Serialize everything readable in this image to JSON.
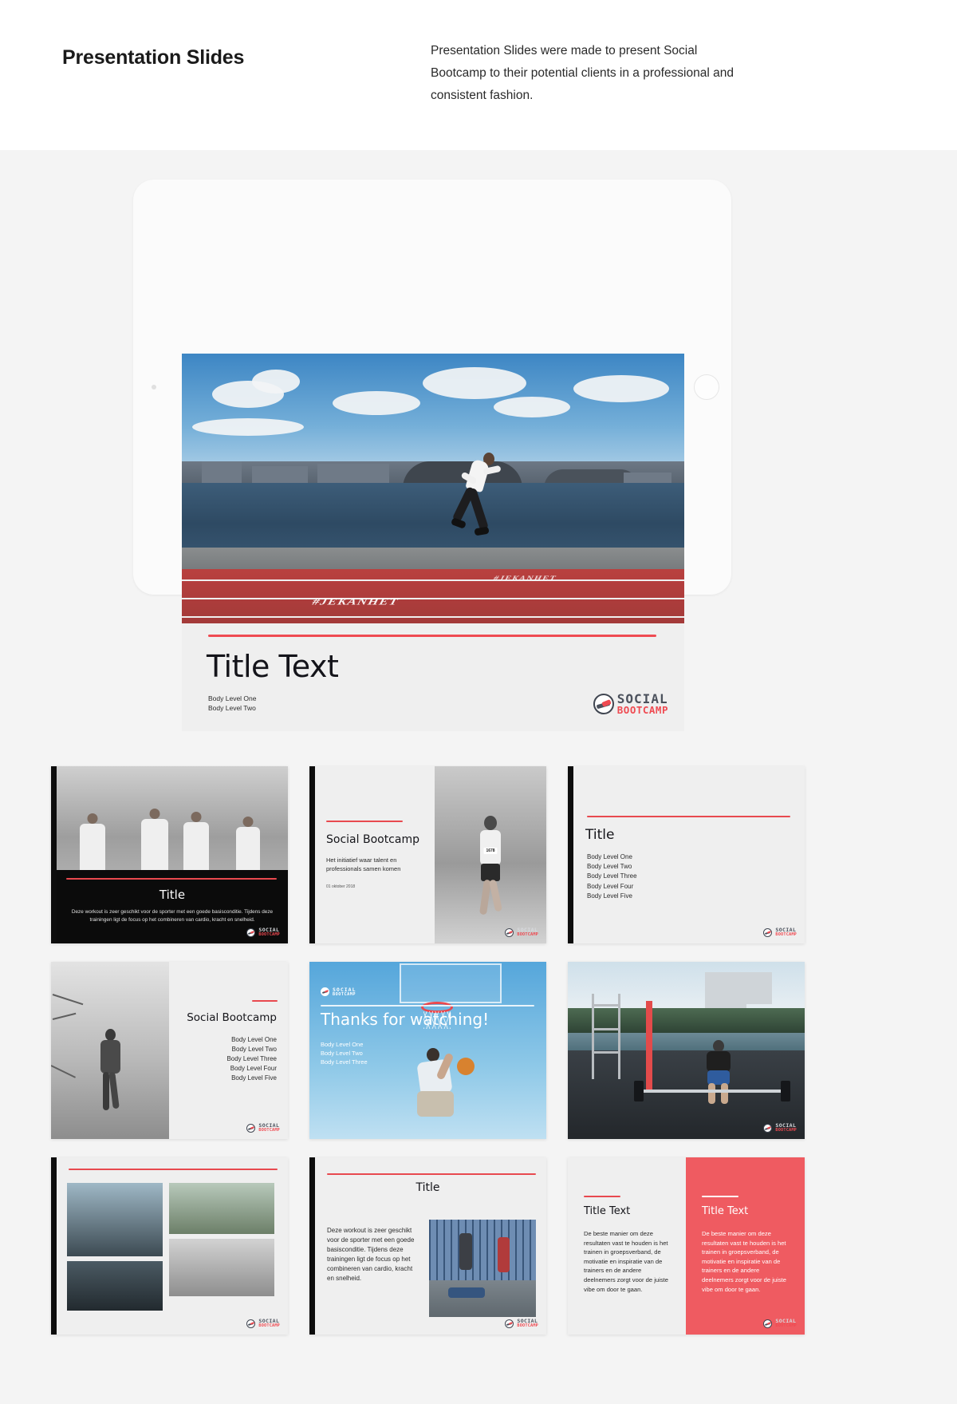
{
  "header": {
    "title": "Presentation Slides",
    "description": "Presentation Slides were made to present Social Bootcamp to their potential clients in a professional and consistent fashion."
  },
  "brand": {
    "accent_red": "#ef4b52",
    "panel_red": "#ef5b61",
    "dark": "#0d0d0d",
    "logo_top": "SOCIAL",
    "logo_bottom": "BOOTCAMP"
  },
  "hero_slide": {
    "title": "Title Text",
    "bullet_one": "Body Level One",
    "bullet_two": "Body Level Two",
    "track_text": "#JEKANHET"
  },
  "slides": [
    {
      "id": "slide-marathon-title",
      "title": "Title",
      "body": "Deze workout is zeer geschikt voor de sporter met een goede basisconditie. Tijdens deze trainingen ligt de focus op het combineren van cardio, kracht en snelheid."
    },
    {
      "id": "slide-cover-social-bootcamp",
      "title": "Social Bootcamp",
      "subtitle": "Het initiatief waar talent en professionals samen komen",
      "date": "01 oktober 2018",
      "bib": "1678"
    },
    {
      "id": "slide-title-bullets",
      "title": "Title",
      "bullets": [
        "Body Level One",
        "Body Level Two",
        "Body Level Three",
        "Body Level Four",
        "Body Level Five"
      ]
    },
    {
      "id": "slide-walker-bullets",
      "title": "Social Bootcamp",
      "bullets": [
        "Body Level One",
        "Body Level Two",
        "Body Level Three",
        "Body Level Four",
        "Body Level Five"
      ]
    },
    {
      "id": "slide-thanks-for-watching",
      "title": "Thanks for watching!",
      "bullets": [
        "Body Level One",
        "Body Level Two",
        "Body Level Three"
      ]
    },
    {
      "id": "slide-outdoor-gym-photo"
    },
    {
      "id": "slide-photo-collage"
    },
    {
      "id": "slide-title-paragraph-photo",
      "title": "Title",
      "body": "Deze workout is zeer geschikt voor de sporter met een goede basisconditie. Tijdens deze trainingen ligt de focus op het combineren van cardio, kracht en snelheid."
    },
    {
      "id": "slide-two-panel-red",
      "left_title": "Title Text",
      "right_title": "Title Text",
      "left_body": "De beste manier om deze resultaten vast te houden is het trainen in groepsverband, de motivatie en inspiratie van de trainers en de andere deelnemers zorgt voor de juiste vibe om door te gaan.",
      "right_body": "De beste manier om deze resultaten vast te houden is het trainen in groepsverband, de motivatie en inspiratie van de trainers en de andere deelnemers zorgt voor de juiste vibe om door te gaan."
    }
  ]
}
